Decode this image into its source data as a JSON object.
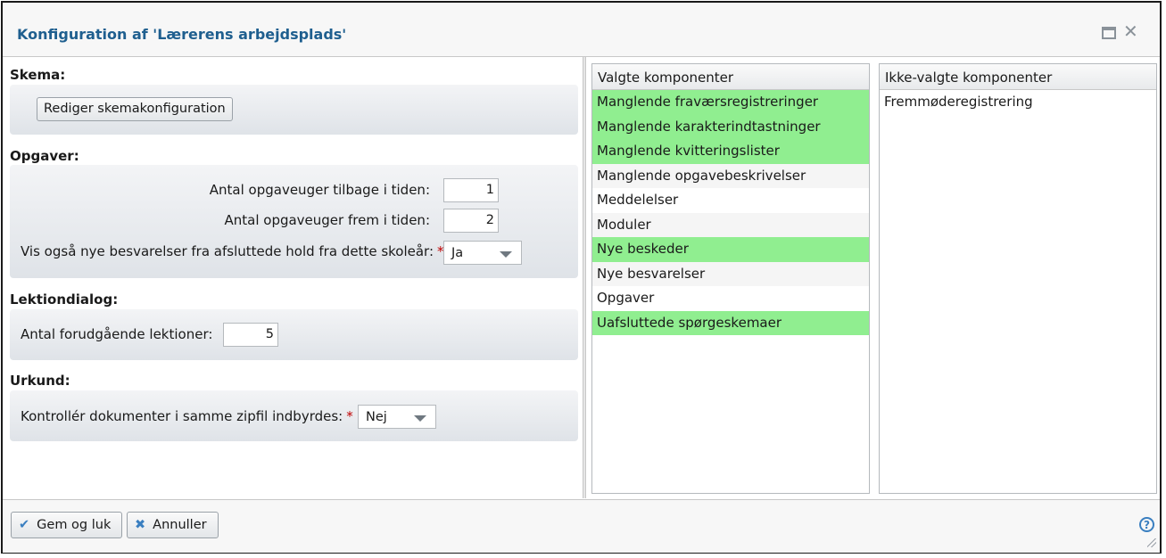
{
  "window": {
    "title": "Konfiguration af 'Lærerens arbejdsplads'",
    "maximize_icon": "maximize-icon",
    "close_icon": "close-icon",
    "close_glyph": "✕"
  },
  "schedule": {
    "heading": "Skema:",
    "edit_button": "Rediger skemakonfiguration"
  },
  "assignments": {
    "heading": "Opgaver:",
    "weeks_back_label": "Antal opgaveuger tilbage i tiden:",
    "weeks_back_value": "1",
    "weeks_forward_label": "Antal opgaveuger frem i tiden:",
    "weeks_forward_value": "2",
    "show_submissions_label": "Vis også nye besvarelser fra afsluttede hold fra dette skoleår:",
    "show_submissions_value": "Ja",
    "required_marker": "*"
  },
  "lesson_dialog": {
    "heading": "Lektiondialog:",
    "previous_lessons_label": "Antal forudgående lektioner:",
    "previous_lessons_value": "5"
  },
  "urkund": {
    "heading": "Urkund:",
    "check_zip_label": "Kontrollér dokumenter i samme zipfil indbyrdes:",
    "check_zip_value": "Nej",
    "required_marker": "*"
  },
  "selected_components": {
    "header": "Valgte komponenter",
    "items": [
      {
        "label": "Manglende fraværsregistreringer",
        "selected": true
      },
      {
        "label": "Manglende karakterindtastninger",
        "selected": true
      },
      {
        "label": "Manglende kvitteringslister",
        "selected": true
      },
      {
        "label": "Manglende opgavebeskrivelser",
        "selected": false
      },
      {
        "label": "Meddelelser",
        "selected": false
      },
      {
        "label": "Moduler",
        "selected": false
      },
      {
        "label": "Nye beskeder",
        "selected": true
      },
      {
        "label": "Nye besvarelser",
        "selected": false
      },
      {
        "label": "Opgaver",
        "selected": false
      },
      {
        "label": "Uafsluttede spørgeskemaer",
        "selected": true
      }
    ]
  },
  "unselected_components": {
    "header": "Ikke-valgte komponenter",
    "items": [
      {
        "label": "Fremmøderegistrering"
      }
    ]
  },
  "footer": {
    "save_label": "Gem og luk",
    "cancel_label": "Annuller",
    "save_icon": "✔",
    "cancel_icon": "✖",
    "help_glyph": "?"
  },
  "colors": {
    "title": "#1f5f8f",
    "selected_row": "#90ee90",
    "required": "#c00000",
    "icon_blue": "#3a7fc0"
  }
}
